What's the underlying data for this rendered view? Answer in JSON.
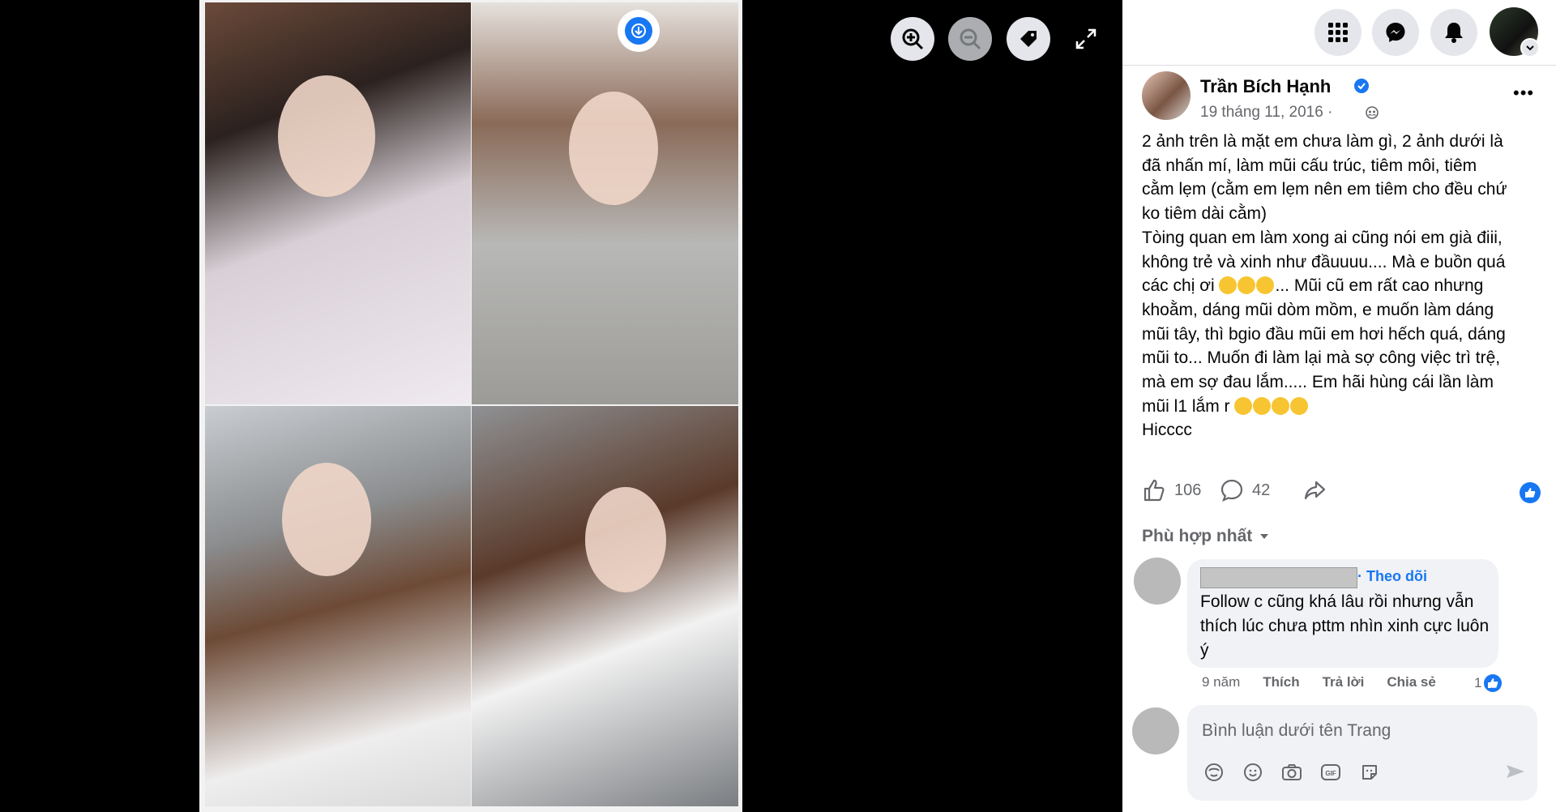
{
  "viewer": {
    "toolbar": {
      "zoom_in": "zoom-in-icon",
      "zoom_out": "zoom-out-icon",
      "tag": "tag-icon",
      "fullscreen": "fullscreen-icon",
      "download": "download-icon"
    }
  },
  "header": {
    "icons": [
      "menu-grid-icon",
      "messenger-icon",
      "notifications-icon",
      "profile-avatar"
    ]
  },
  "post": {
    "author": "Trần Bích Hạnh",
    "verified": true,
    "date": "19 tháng 11, 2016 ·",
    "audience_icon": "friends-icon",
    "body_lines": [
      "2 ảnh trên là mặt em chưa làm gì, 2 ảnh dưới là",
      "đã nhấn mí, làm mũi cấu trúc, tiêm môi, tiêm",
      "cằm lẹm (cằm em lẹm nên em tiêm cho đều chứ",
      "ko tiêm dài cằm)",
      "Tòing quan em làm xong ai cũng nói em già điii,",
      "không trẻ và xinh như đầuuuu.... Mà e buồn quá",
      "các chị ơi",
      "... Mũi cũ em rất cao nhưng",
      "khoằm, dáng mũi dòm mồm, e muốn làm dáng",
      "mũi tây, thì bgio đầu mũi em hơi hếch quá, dáng",
      "mũi to... Muốn đi làm lại mà sợ công việc trì trệ,",
      "mà em sợ đau lắm..... Em hãi hùng cái lần làm",
      "mũi l1 lắm r",
      "Hicccc"
    ],
    "likes": "106",
    "comments": "42",
    "sort_label": "Phù hợp nhất"
  },
  "comment": {
    "follow_label": "· Theo dõi",
    "text": "Follow c cũng khá lâu rồi nhưng vẫn thích lúc chưa pttm nhìn xinh cực luôn ý",
    "time": "9 năm",
    "like_label": "Thích",
    "reply_label": "Trả lời",
    "share_label": "Chia sẻ",
    "reaction_count": "1"
  },
  "composer": {
    "placeholder": "Bình luận dưới tên Trang",
    "tools": [
      "avatar-sticker-icon",
      "emoji-icon",
      "camera-icon",
      "gif-icon",
      "sticker-icon"
    ]
  },
  "colors": {
    "accent": "#1877f2",
    "panel_bg": "#ffffff",
    "secondary_text": "#65676b"
  }
}
